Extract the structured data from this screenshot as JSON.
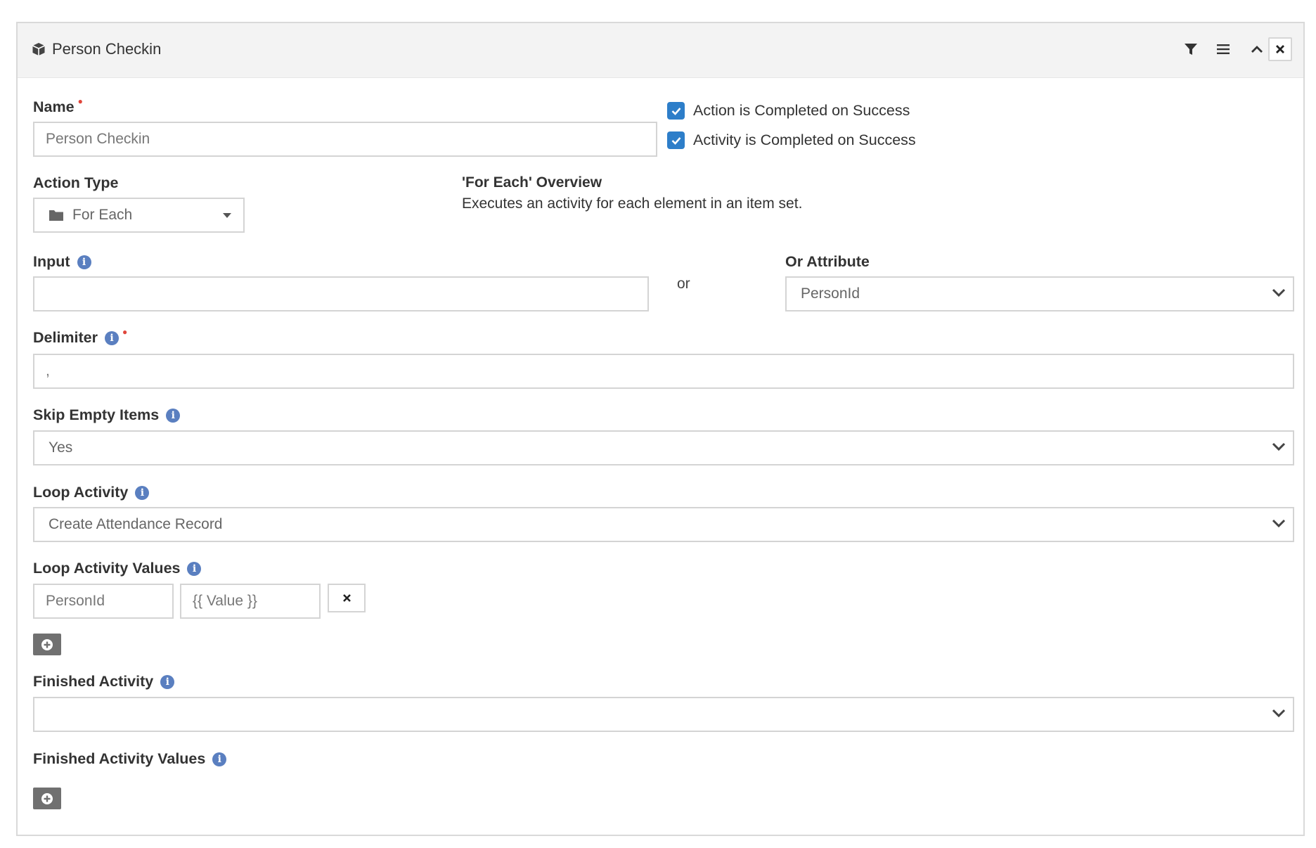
{
  "panel": {
    "title": "Person Checkin",
    "header_icons": [
      "cube-icon",
      "filter-icon",
      "menu-icon",
      "chevron-up-icon",
      "close-icon"
    ]
  },
  "name_field": {
    "label": "Name",
    "value": "Person Checkin"
  },
  "checkboxes": [
    {
      "label": "Action is Completed on Success",
      "checked": true
    },
    {
      "label": "Activity is Completed on Success",
      "checked": true
    }
  ],
  "action_type": {
    "label": "Action Type",
    "value": "For Each"
  },
  "overview": {
    "title": "'For Each' Overview",
    "description": "Executes an activity for each element in an item set."
  },
  "input_field": {
    "label": "Input",
    "value": "",
    "or_text": "or"
  },
  "or_attribute": {
    "label": "Or Attribute",
    "value": "PersonId"
  },
  "delimiter": {
    "label": "Delimiter",
    "value": ","
  },
  "skip_empty": {
    "label": "Skip Empty Items",
    "value": "Yes"
  },
  "loop_activity": {
    "label": "Loop Activity",
    "value": "Create Attendance Record"
  },
  "loop_activity_values": {
    "label": "Loop Activity Values",
    "key": "PersonId",
    "value": "{{ Value }}"
  },
  "finished_activity": {
    "label": "Finished Activity",
    "value": ""
  },
  "finished_activity_values": {
    "label": "Finished Activity Values"
  },
  "colors": {
    "accent": "#2d7ec9",
    "info": "#5a7fc0",
    "required": "#e0463b",
    "header_bg": "#f3f3f3",
    "add_button": "#707070"
  }
}
